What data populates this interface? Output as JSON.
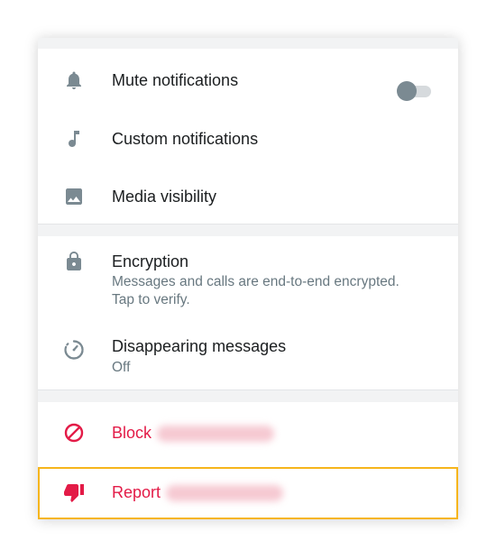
{
  "notifications": {
    "mute": {
      "label": "Mute notifications",
      "toggle_on": false,
      "icon": "bell-icon"
    },
    "custom": {
      "label": "Custom notifications",
      "icon": "music-note-icon"
    },
    "media": {
      "label": "Media visibility",
      "icon": "image-icon"
    }
  },
  "privacy": {
    "encryption": {
      "label": "Encryption",
      "description": "Messages and calls are end-to-end encrypted. Tap to verify.",
      "icon": "lock-icon"
    },
    "disappearing": {
      "label": "Disappearing messages",
      "status": "Off",
      "icon": "timer-icon"
    }
  },
  "danger": {
    "block": {
      "label": "Block",
      "icon": "block-icon"
    },
    "report": {
      "label": "Report",
      "icon": "thumbs-down-icon"
    }
  },
  "colors": {
    "danger": "#e31b47",
    "icon_gray": "#7b8a92",
    "highlight": "#f6b51c"
  }
}
